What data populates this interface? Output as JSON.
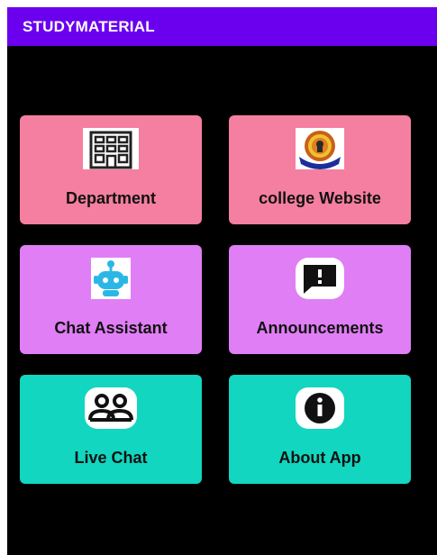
{
  "app": {
    "title": "STUDYMATERIAL"
  },
  "colors": {
    "appbar": "#6a00ee",
    "pink": "#f57fa0",
    "violet": "#e07ef5",
    "teal": "#12d6c0"
  },
  "cards": [
    {
      "label": "Department",
      "icon": "building-icon"
    },
    {
      "label": "college Website",
      "icon": "college-logo-icon"
    },
    {
      "label": "Chat Assistant",
      "icon": "robot-icon"
    },
    {
      "label": "Announcements",
      "icon": "announcement-icon"
    },
    {
      "label": "Live Chat",
      "icon": "people-icon"
    },
    {
      "label": "About App",
      "icon": "info-icon"
    }
  ]
}
